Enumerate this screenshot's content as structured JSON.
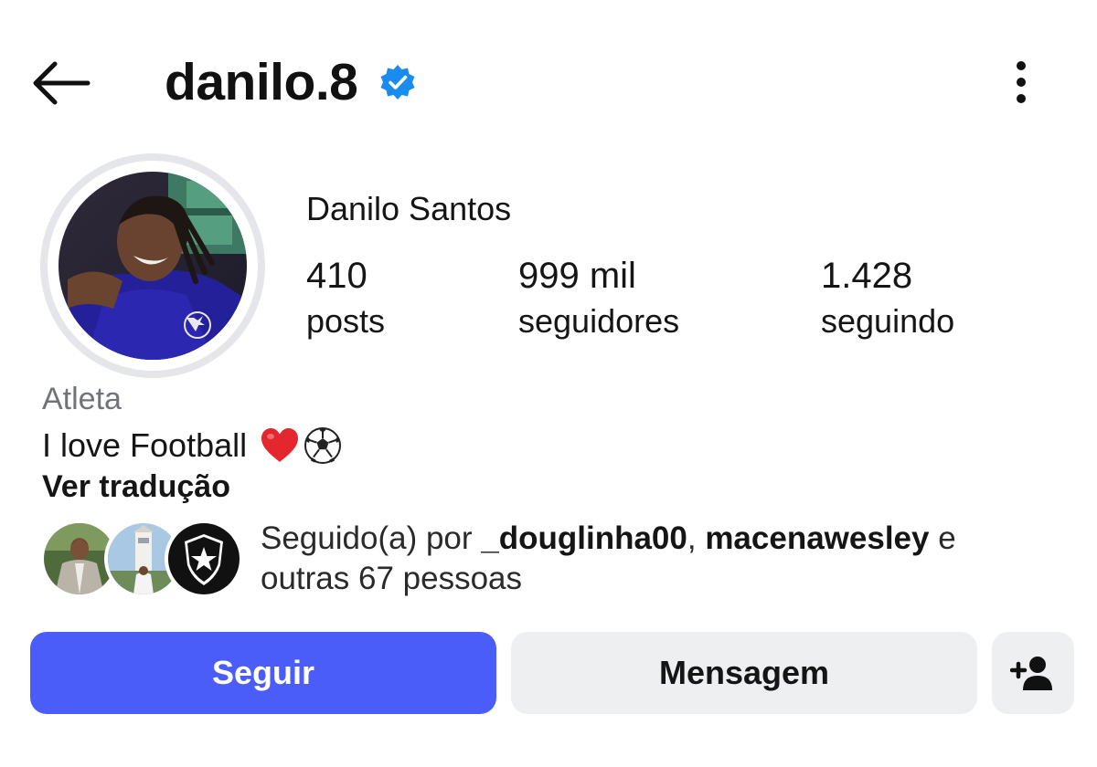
{
  "header": {
    "username": "danilo.8",
    "verified_color": "#1a8cf0"
  },
  "profile": {
    "full_name": "Danilo Santos",
    "stats": [
      {
        "value": "410",
        "label": "posts"
      },
      {
        "value": "999 mil",
        "label": "seguidores"
      },
      {
        "value": "1.428",
        "label": "seguindo"
      }
    ],
    "category": "Atleta",
    "bio_text": "I love Football",
    "bio_emojis": [
      "red-heart",
      "soccer-ball"
    ],
    "translate_label": "Ver tradução"
  },
  "followed_by": {
    "prefix": "Seguido(a) por ",
    "user1": "_douglinha00",
    "separator": ", ",
    "user2": "macenawesley",
    "conjunction": " e",
    "rest": "outras 67 pessoas"
  },
  "actions": {
    "follow_label": "Seguir",
    "message_label": "Mensagem",
    "follow_color": "#4a5df9",
    "suggest_icon": "add-person-icon"
  },
  "icons": {
    "back": "back-arrow-icon",
    "more": "more-vertical-icon",
    "verified": "verified-badge-icon"
  }
}
